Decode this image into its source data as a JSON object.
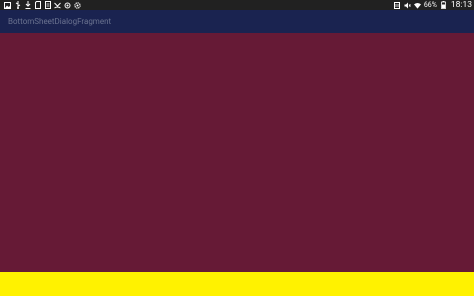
{
  "app": {
    "title": "BottomSheetDialogFragment"
  },
  "status_bar": {
    "left_icons": [
      "image-icon",
      "usb-icon",
      "download-icon",
      "sd-card-icon",
      "document-icon",
      "missed-call-icon",
      "cast-icon",
      "settings-icon"
    ],
    "right_icons": [
      "nfc-icon",
      "mute-icon",
      "wifi-icon",
      "battery-icon"
    ],
    "battery_percent": "66%",
    "time": "18:13"
  },
  "colors": {
    "status_bar_bg": "#212121",
    "toolbar_bg": "#1a2350",
    "toolbar_title": "#6b7390",
    "content_bg": "#661a36",
    "bottom_sheet_bg": "#fff200"
  }
}
